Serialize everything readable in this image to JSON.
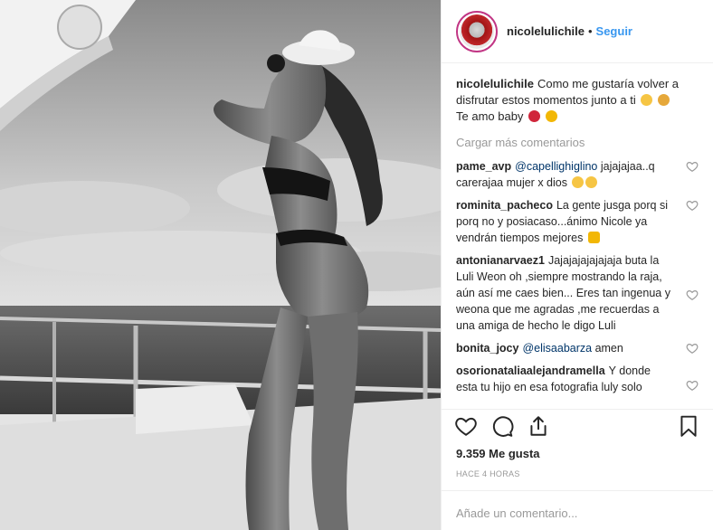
{
  "header": {
    "username": "nicolelulichile",
    "separator": "•",
    "follow_label": "Seguir"
  },
  "caption": {
    "username": "nicolelulichile",
    "text": "Como me gustaría volver a disfrutar estos momentos junto a ti",
    "text2": "Te amo baby",
    "emojis": [
      "baby-emoji",
      "pray-emoji",
      "heart-emoji",
      "sparkle-emoji"
    ]
  },
  "load_more_label": "Cargar más comentarios",
  "comments": [
    {
      "user": "pame_avp",
      "mention": "@capellighiglino",
      "text": " jajajajaa..q carerajaa mujer x dios",
      "emojis": [
        "laugh-emoji",
        "laugh-emoji"
      ]
    },
    {
      "user": "rominita_pacheco",
      "mention": "",
      "text": "La gente jusga porq si porq no y posiacaso...ánimo Nicole ya vendrán tiempos mejores",
      "emojis": [
        "flex-emoji"
      ]
    },
    {
      "user": "antonianarvaez1",
      "mention": "",
      "text": "Jajajajajajajaja buta la Luli Weon oh ,siempre mostrando la raja, aún así me caes bien... Eres tan ingenua y weona que me agradas ,me recuerdas a una amiga de hecho le digo Luli",
      "emojis": []
    },
    {
      "user": "bonita_jocy",
      "mention": "@elisaabarza",
      "text": " amen",
      "emojis": []
    },
    {
      "user": "osorionataliaalejandramella",
      "mention": "",
      "text": "Y donde esta tu hijo en esa fotografia luly solo",
      "emojis": []
    }
  ],
  "likes": {
    "count": "9.359",
    "label": "Me gusta"
  },
  "time_label": "HACE 4 HORAS",
  "comment_input": {
    "placeholder": "Añade un comentario..."
  },
  "colors": {
    "accent": "#3897f0",
    "text": "#262626",
    "muted": "#999999",
    "border": "#efefef"
  }
}
